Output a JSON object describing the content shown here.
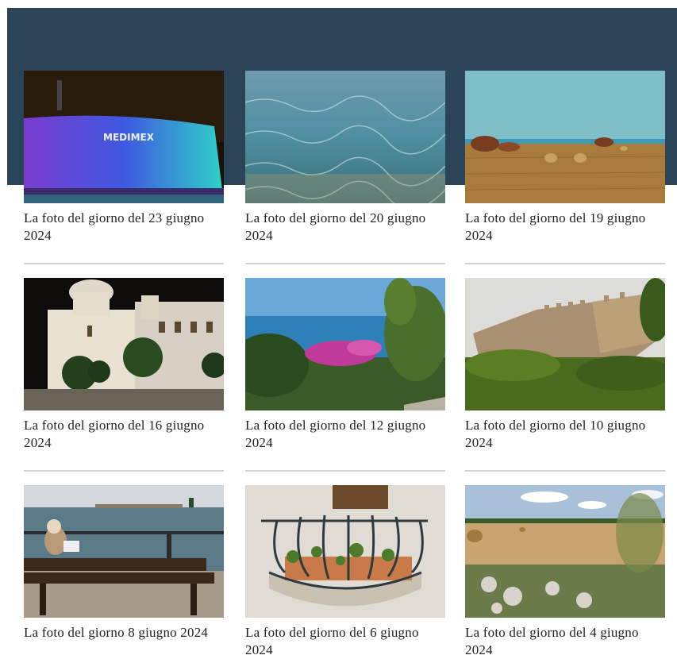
{
  "header": {
    "background_color": "#2c4458"
  },
  "gallery": {
    "items": [
      {
        "caption": "La foto del giorno del 23 giugno 2024",
        "image": "medimex-illuminated-building-night"
      },
      {
        "caption": "La foto del giorno del 20 giugno 2024",
        "image": "clear-sea-water"
      },
      {
        "caption": "La foto del giorno del 19 giugno 2024",
        "image": "hay-bales-field-sea"
      },
      {
        "caption": "La foto del giorno del 16 giugno 2024",
        "image": "white-church-night"
      },
      {
        "caption": "La foto del giorno del 12 giugno 2024",
        "image": "sea-view-bougainvillea"
      },
      {
        "caption": "La foto del giorno del 10 giugno 2024",
        "image": "castle-walls-vegetation"
      },
      {
        "caption": "La foto del giorno 8 giugno 2024",
        "image": "person-on-bench-harbor"
      },
      {
        "caption": "La foto del giorno del 6 giugno 2024",
        "image": "wrought-iron-balcony-plants"
      },
      {
        "caption": "La foto del giorno del 4 giugno 2024",
        "image": "countryside-field-hay-bales"
      }
    ],
    "medimex_sign": "MEDIMEX"
  }
}
